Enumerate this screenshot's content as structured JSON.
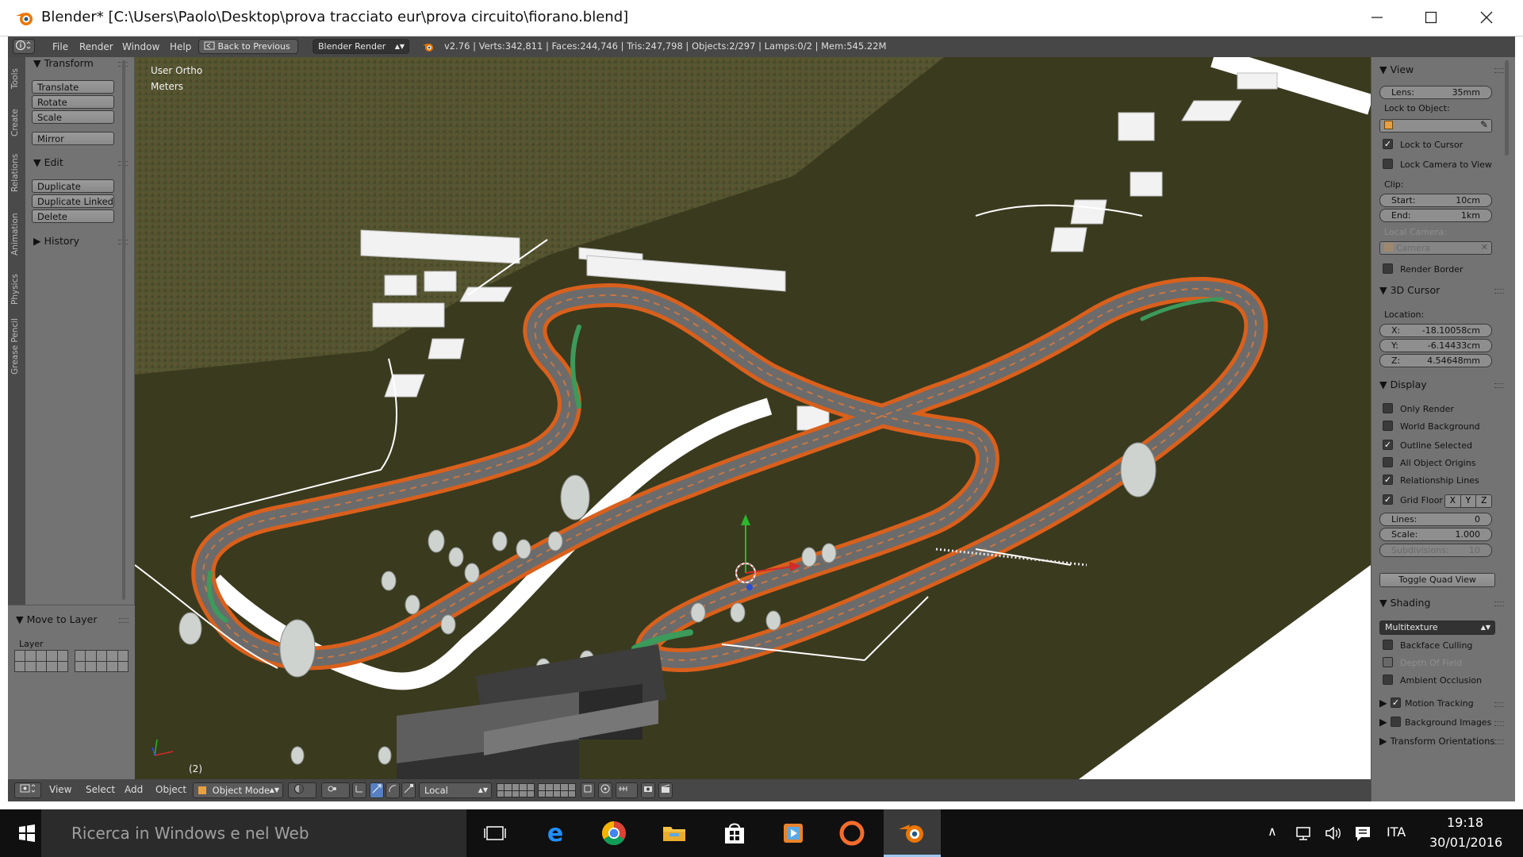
{
  "window": {
    "title": "Blender* [C:\\Users\\Paolo\\Desktop\\prova tracciato eur\\prova circuito\\fiorano.blend]",
    "minimize_icon": "minimize-icon",
    "maximize_icon": "maximize-icon",
    "close_icon": "close-icon"
  },
  "info_header": {
    "menus": [
      "File",
      "Render",
      "Window",
      "Help"
    ],
    "back_button": "Back to Previous",
    "render_engine": "Blender Render",
    "stats": "v2.76 | Verts:342,811 | Faces:244,746 | Tris:247,798 | Objects:2/297 | Lamps:0/2 | Mem:545.22M"
  },
  "tool_tabs": [
    "Tools",
    "Create",
    "Relations",
    "Animation",
    "Physics",
    "Grease Pencil"
  ],
  "tool_shelf": {
    "transform_title": "Transform",
    "transform_buttons": [
      "Translate",
      "Rotate",
      "Scale"
    ],
    "mirror_button": "Mirror",
    "edit_title": "Edit",
    "edit_buttons": [
      "Duplicate",
      "Duplicate Linked",
      "Delete"
    ],
    "history_title": "History"
  },
  "last_operator": {
    "title": "Move to Layer",
    "layer_label": "Layer"
  },
  "viewport": {
    "view_name": "User Ortho",
    "units": "Meters",
    "frame": "(2)"
  },
  "properties": {
    "view_title": "View",
    "lens_label": "Lens:",
    "lens_value": "35mm",
    "lock_to_object": "Lock to Object:",
    "lock_to_cursor": "Lock to Cursor",
    "lock_camera_to_view": "Lock Camera to View",
    "clip_label": "Clip:",
    "clip_start_label": "Start:",
    "clip_start_value": "10cm",
    "clip_end_label": "End:",
    "clip_end_value": "1km",
    "local_camera_label": "Local Camera:",
    "local_camera_value": "Camera",
    "render_border": "Render Border",
    "cursor_title": "3D Cursor",
    "location_label": "Location:",
    "x_label": "X:",
    "x_value": "-18.10058cm",
    "y_label": "Y:",
    "y_value": "-6.14433cm",
    "z_label": "Z:",
    "z_value": "4.54648mm",
    "display_title": "Display",
    "display_options": [
      {
        "label": "Only Render",
        "checked": false
      },
      {
        "label": "World Background",
        "checked": false
      },
      {
        "label": "Outline Selected",
        "checked": true
      },
      {
        "label": "All Object Origins",
        "checked": false
      },
      {
        "label": "Relationship Lines",
        "checked": true
      },
      {
        "label": "Grid Floor",
        "checked": true
      }
    ],
    "axis_x": "X",
    "axis_y": "Y",
    "axis_z": "Z",
    "lines_label": "Lines:",
    "lines_value": "0",
    "scale_label": "Scale:",
    "scale_value": "1.000",
    "subdivisions_label": "Subdivisions:",
    "subdivisions_value": "10",
    "toggle_quad_view": "Toggle Quad View",
    "shading_title": "Shading",
    "shading_mode": "Multitexture",
    "backface_culling": "Backface Culling",
    "depth_of_field": "Depth Of Field",
    "ambient_occlusion": "Ambient Occlusion",
    "motion_tracking": "Motion Tracking",
    "background_images": "Background Images",
    "transform_orientations": "Transform Orientations"
  },
  "header_3d": {
    "menus": [
      "View",
      "Select",
      "Add",
      "Object"
    ],
    "mode": "Object Mode",
    "orientation": "Local"
  },
  "taskbar": {
    "search_placeholder": "Ricerca in Windows e nel Web",
    "language": "ITA",
    "time": "19:18",
    "date": "30/01/2016"
  },
  "colors": {
    "title_bar": "#ffffff",
    "blender_panel": "#737373",
    "blender_header": "#474747",
    "track_orange": "#d9601c",
    "ground": "#3a3a1f",
    "taskbar": "#101010"
  }
}
